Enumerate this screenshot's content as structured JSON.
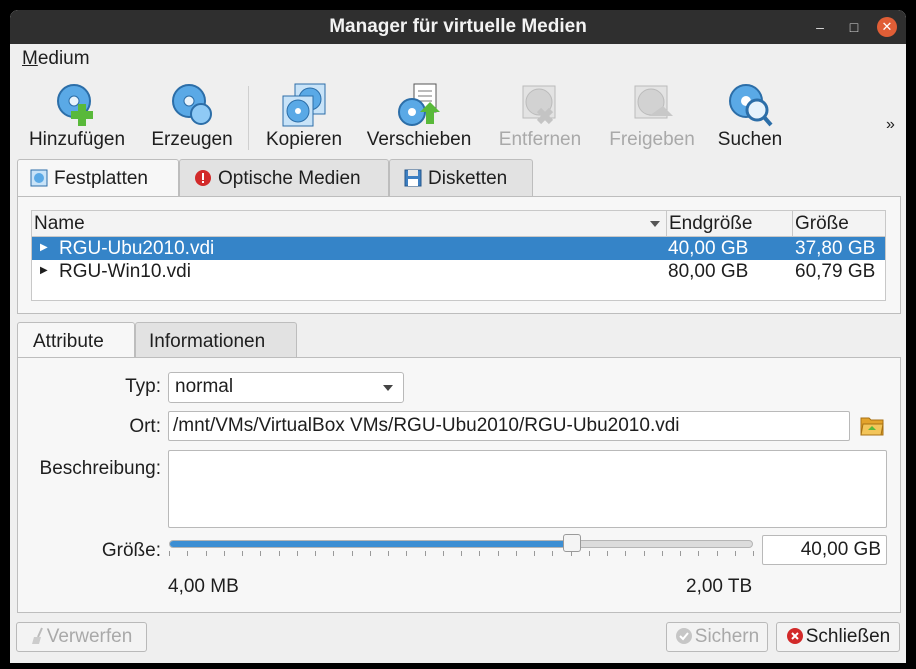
{
  "window": {
    "title": "Manager für virtuelle Medien"
  },
  "controls": {
    "minimize": "–",
    "maximize": "□",
    "close": "✕"
  },
  "menu": {
    "medium": "Medium"
  },
  "toolbar": {
    "items": [
      {
        "label": "Hinzufügen",
        "icon": "add-disk-icon",
        "enabled": true
      },
      {
        "label": "Erzeugen",
        "icon": "create-disk-icon",
        "enabled": true
      },
      {
        "label": "Kopieren",
        "icon": "copy-disk-icon",
        "enabled": true
      },
      {
        "label": "Verschieben",
        "icon": "move-disk-icon",
        "enabled": true
      },
      {
        "label": "Entfernen",
        "icon": "remove-disk-icon",
        "enabled": false
      },
      {
        "label": "Freigeben",
        "icon": "release-disk-icon",
        "enabled": false
      },
      {
        "label": "Suchen",
        "icon": "search-disk-icon",
        "enabled": true
      }
    ],
    "more": "»"
  },
  "media_tabs": [
    "Festplatten",
    "Optische Medien",
    "Disketten"
  ],
  "table": {
    "headers": [
      "Name",
      "Endgröße",
      "Größe"
    ],
    "rows": [
      {
        "name": "RGU-Ubu2010.vdi",
        "endsize": "40,00 GB",
        "size": "37,80 GB",
        "selected": true
      },
      {
        "name": "RGU-Win10.vdi",
        "endsize": "80,00 GB",
        "size": "60,79 GB",
        "selected": false
      }
    ]
  },
  "detail_tabs": [
    "Attribute",
    "Informationen"
  ],
  "attributes": {
    "type_label": "Typ:",
    "type_value": "normal",
    "location_label": "Ort:",
    "location_value": "/mnt/VMs/VirtualBox VMs/RGU-Ubu2010/RGU-Ubu2010.vdi",
    "description_label": "Beschreibung:",
    "description_value": "",
    "size_label": "Größe:",
    "size_value": "40,00 GB",
    "size_min": "4,00 MB",
    "size_max": "2,00 TB",
    "slider_fraction": 0.69
  },
  "buttons": {
    "reset": "Verwerfen",
    "apply": "Sichern",
    "close": "Schließen"
  },
  "colors": {
    "selection": "#3584c8",
    "slider_fill": "#3c8ed3",
    "close_icon": "#e05e36"
  }
}
